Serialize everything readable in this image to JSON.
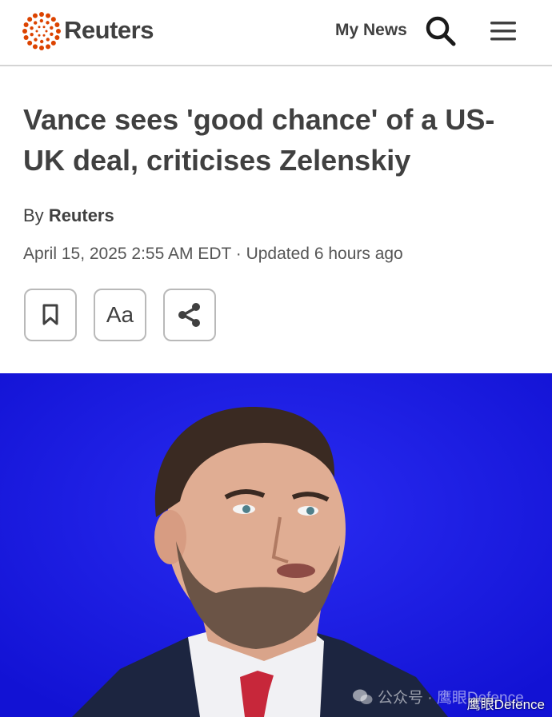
{
  "header": {
    "brand": "Reuters",
    "my_news_label": "My News",
    "search_icon": "search-icon",
    "menu_icon": "hamburger-menu-icon",
    "logo_color": "#dc4300"
  },
  "article": {
    "headline": "Vance sees 'good chance' of a US-UK deal, criticises Zelenskiy",
    "byline_prefix": "By",
    "byline_author": "Reuters",
    "dateline": "April 15, 2025 2:55 AM EDT · Updated 6 hours ago"
  },
  "toolbar": {
    "bookmark_icon": "bookmark-icon",
    "font_size_label": "Aa",
    "share_icon": "share-icon"
  },
  "image": {
    "background_color": "#1a1ae8"
  },
  "watermark": {
    "primary": "公众号 · 鹰眼Defence",
    "secondary": "鹰眼Defence"
  }
}
